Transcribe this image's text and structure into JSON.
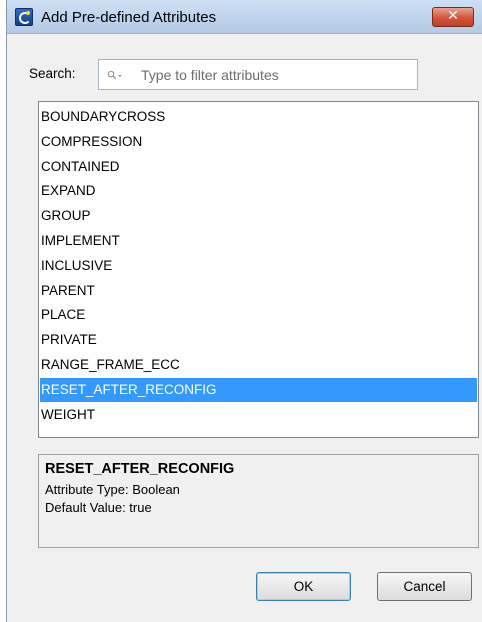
{
  "window": {
    "title": "Add Pre-defined Attributes",
    "close_glyph": "✕"
  },
  "search": {
    "label": "Search:",
    "placeholder": "Type to filter attributes",
    "icon": "search-icon"
  },
  "attributes": [
    "BOUNDARYCROSS",
    "COMPRESSION",
    "CONTAINED",
    "EXPAND",
    "GROUP",
    "IMPLEMENT",
    "INCLUSIVE",
    "PARENT",
    "PLACE",
    "PRIVATE",
    "RANGE_FRAME_ECC",
    "RESET_AFTER_RECONFIG",
    "WEIGHT"
  ],
  "selected_attribute": "RESET_AFTER_RECONFIG",
  "details": {
    "name": "RESET_AFTER_RECONFIG",
    "type_line": "Attribute Type: Boolean",
    "default_line": "Default Value: true"
  },
  "buttons": {
    "ok": "OK",
    "cancel": "Cancel"
  },
  "colors": {
    "selection": "#3399ff",
    "close_button": "#c2402a"
  }
}
